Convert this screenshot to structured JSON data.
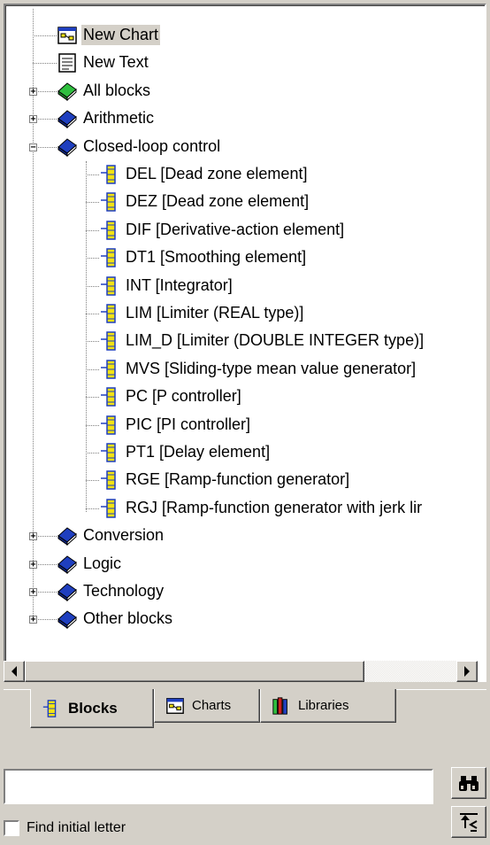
{
  "tree": {
    "items": [
      {
        "label": "New Chart",
        "icon": "chart-icon",
        "level": 1,
        "expander": "none",
        "selected": true
      },
      {
        "label": "New Text",
        "icon": "text-document-icon",
        "level": 1,
        "expander": "none"
      },
      {
        "label": "All blocks",
        "icon": "green-book-icon",
        "level": 0,
        "expander": "+"
      },
      {
        "label": "Arithmetic",
        "icon": "blue-book-icon",
        "level": 0,
        "expander": "+"
      },
      {
        "label": "Closed-loop control",
        "icon": "blue-book-icon",
        "level": 0,
        "expander": "-"
      },
      {
        "label": "DEL [Dead zone element]",
        "icon": "block-icon",
        "level": 2,
        "expander": "none"
      },
      {
        "label": "DEZ [Dead zone element]",
        "icon": "block-icon",
        "level": 2,
        "expander": "none"
      },
      {
        "label": "DIF [Derivative-action element]",
        "icon": "block-icon",
        "level": 2,
        "expander": "none"
      },
      {
        "label": "DT1 [Smoothing element]",
        "icon": "block-icon",
        "level": 2,
        "expander": "none"
      },
      {
        "label": "INT [Integrator]",
        "icon": "block-icon",
        "level": 2,
        "expander": "none"
      },
      {
        "label": "LIM [Limiter (REAL type)]",
        "icon": "block-icon",
        "level": 2,
        "expander": "none"
      },
      {
        "label": "LIM_D [Limiter (DOUBLE INTEGER type)]",
        "icon": "block-icon",
        "level": 2,
        "expander": "none"
      },
      {
        "label": "MVS [Sliding-type mean value generator]",
        "icon": "block-icon",
        "level": 2,
        "expander": "none"
      },
      {
        "label": "PC [P controller]",
        "icon": "block-icon",
        "level": 2,
        "expander": "none"
      },
      {
        "label": "PIC [PI controller]",
        "icon": "block-icon",
        "level": 2,
        "expander": "none"
      },
      {
        "label": "PT1 [Delay element]",
        "icon": "block-icon",
        "level": 2,
        "expander": "none"
      },
      {
        "label": "RGE [Ramp-function generator]",
        "icon": "block-icon",
        "level": 2,
        "expander": "none"
      },
      {
        "label": "RGJ [Ramp-function generator with jerk lir",
        "icon": "block-icon",
        "level": 2,
        "expander": "none"
      },
      {
        "label": "Conversion",
        "icon": "blue-book-icon",
        "level": 0,
        "expander": "+"
      },
      {
        "label": "Logic",
        "icon": "blue-book-icon",
        "level": 0,
        "expander": "+"
      },
      {
        "label": "Technology",
        "icon": "blue-book-icon",
        "level": 0,
        "expander": "+"
      },
      {
        "label": "Other blocks",
        "icon": "blue-book-icon",
        "level": 0,
        "expander": "+"
      }
    ]
  },
  "tabs": [
    {
      "label": "Blocks",
      "icon": "block-icon",
      "active": true
    },
    {
      "label": "Charts",
      "icon": "chart-icon",
      "active": false
    },
    {
      "label": "Libraries",
      "icon": "libraries-icon",
      "active": false
    }
  ],
  "search": {
    "value": "",
    "placeholder": ""
  },
  "find_initial_letter": {
    "label": "Find initial letter",
    "checked": false
  },
  "colors": {
    "window_face": "#d4d0c8",
    "selection": "#d4d0c8",
    "book_blue": "#1f3fbf",
    "book_green": "#2fbf3f",
    "block_yellow": "#f3e313"
  }
}
